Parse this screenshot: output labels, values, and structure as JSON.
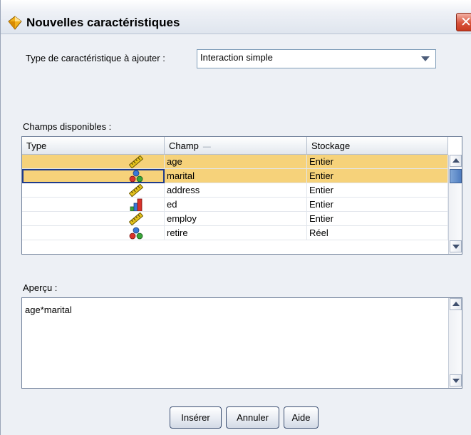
{
  "dialog": {
    "title": "Nouvelles caractéristiques",
    "close_glyph": "✕"
  },
  "feature_type": {
    "label": "Type de caractéristique à ajouter :",
    "selected": "Interaction simple"
  },
  "fields": {
    "label": "Champs disponibles :",
    "columns": [
      "Type",
      "Champ",
      "Stockage"
    ],
    "sort_indicator": "—",
    "rows": [
      {
        "type_icon": "ruler-icon",
        "champ": "age",
        "stockage": "Entier",
        "selected": true
      },
      {
        "type_icon": "nominal-set-icon",
        "champ": "marital",
        "stockage": "Entier",
        "selected": true
      },
      {
        "type_icon": "ruler-icon",
        "champ": "address",
        "stockage": "Entier",
        "selected": false
      },
      {
        "type_icon": "ordinal-bars-icon",
        "champ": "ed",
        "stockage": "Entier",
        "selected": false
      },
      {
        "type_icon": "ruler-icon",
        "champ": "employ",
        "stockage": "Entier",
        "selected": false
      },
      {
        "type_icon": "nominal-set-icon",
        "champ": "retire",
        "stockage": "Réel",
        "selected": false
      }
    ]
  },
  "preview": {
    "label": "Aperçu :",
    "value": "age*marital"
  },
  "buttons": {
    "insert": "Insérer",
    "cancel": "Annuler",
    "help": "Aide"
  },
  "colors": {
    "selection": "#f6d27a",
    "focus_border": "#1f3b8c",
    "window_bg": "#edf0f5"
  }
}
